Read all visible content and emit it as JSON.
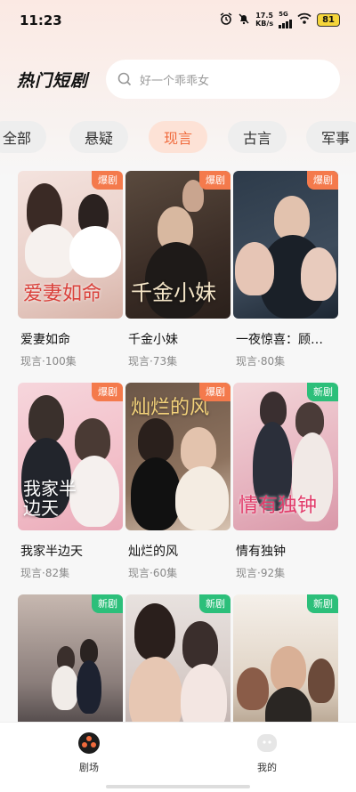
{
  "status": {
    "time": "11:23",
    "speed_value": "17.5",
    "speed_unit": "KB/s",
    "network": "5G",
    "battery": "81"
  },
  "header": {
    "title": "热门短剧",
    "search_placeholder": "好一个乖乖女"
  },
  "tabs": [
    {
      "label": "全部"
    },
    {
      "label": "悬疑"
    },
    {
      "label": "现言"
    },
    {
      "label": "古言"
    },
    {
      "label": "军事"
    }
  ],
  "active_tab": "现言",
  "cards": [
    {
      "name": "爱妻如命",
      "meta": "现言·100集",
      "tag": "爆剧",
      "poster_title": "爱妻如命"
    },
    {
      "name": "千金小妹",
      "meta": "现言·73集",
      "tag": "爆剧",
      "poster_title": "千金小妹"
    },
    {
      "name": "一夜惊喜：顾…",
      "meta": "现言·80集",
      "tag": "爆剧",
      "poster_title": ""
    },
    {
      "name": "我家半边天",
      "meta": "现言·82集",
      "tag": "爆剧",
      "poster_title": "我家半边天"
    },
    {
      "name": "灿烂的风",
      "meta": "现言·60集",
      "tag": "爆剧",
      "poster_title": "灿烂的风"
    },
    {
      "name": "情有独钟",
      "meta": "现言·92集",
      "tag": "新剧",
      "poster_title": "情有独钟"
    },
    {
      "name": "",
      "meta": "",
      "tag": "新剧",
      "poster_title": ""
    },
    {
      "name": "",
      "meta": "",
      "tag": "新剧",
      "poster_title": ""
    },
    {
      "name": "",
      "meta": "",
      "tag": "新剧",
      "poster_title": ""
    }
  ],
  "nav": {
    "theater": "剧场",
    "mine": "我的"
  },
  "colors": {
    "accent": "#f06a3c",
    "hot_tag": "#f47a4c",
    "new_tag": "#2cbf7a"
  }
}
